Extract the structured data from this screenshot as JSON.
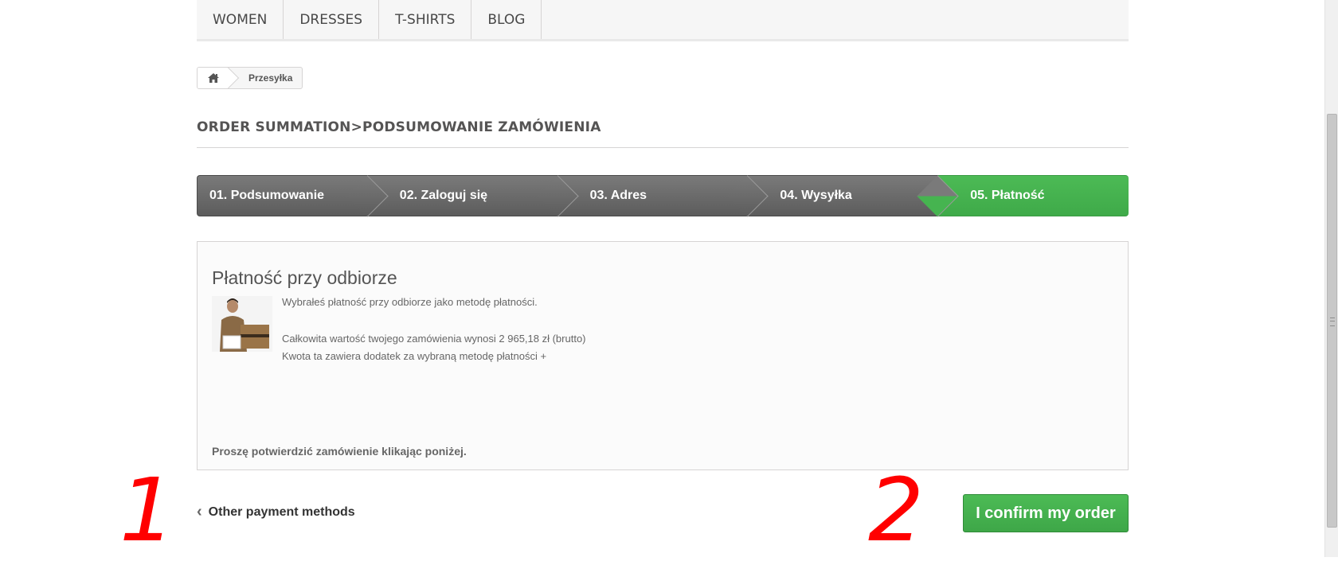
{
  "nav": {
    "items": [
      {
        "label": "WOMEN"
      },
      {
        "label": "DRESSES"
      },
      {
        "label": "T-SHIRTS"
      },
      {
        "label": "BLOG"
      }
    ]
  },
  "breadcrumb": {
    "home_icon": "home-icon",
    "current": "Przesyłka"
  },
  "page_title": "ORDER SUMMATION>PODSUMOWANIE ZAMÓWIENIA",
  "steps": [
    {
      "label": "01. Podsumowanie"
    },
    {
      "label": "02. Zaloguj się"
    },
    {
      "label": "03. Adres"
    },
    {
      "label": "04. Wysyłka"
    },
    {
      "label": "05. Płatność",
      "active": true
    }
  ],
  "payment": {
    "title": "Płatność przy odbiorze",
    "line1": "Wybrałeś płatność przy odbiorze jako metodę płatności.",
    "line2": "Całkowita wartość twojego zamówienia wynosi 2 965,18 zł (brutto)",
    "line3": "Kwota ta zawiera dodatek za wybraną metodę płatności +",
    "confirm_note": "Proszę potwierdzić zamówienie klikając poniżej."
  },
  "actions": {
    "other_payment": "Other payment methods",
    "confirm": "I confirm my order"
  },
  "annotations": {
    "first": "1",
    "second": "2"
  },
  "colors": {
    "accent_green": "#46b450",
    "step_gray": "#666666",
    "annotation_red": "#ff0000"
  }
}
